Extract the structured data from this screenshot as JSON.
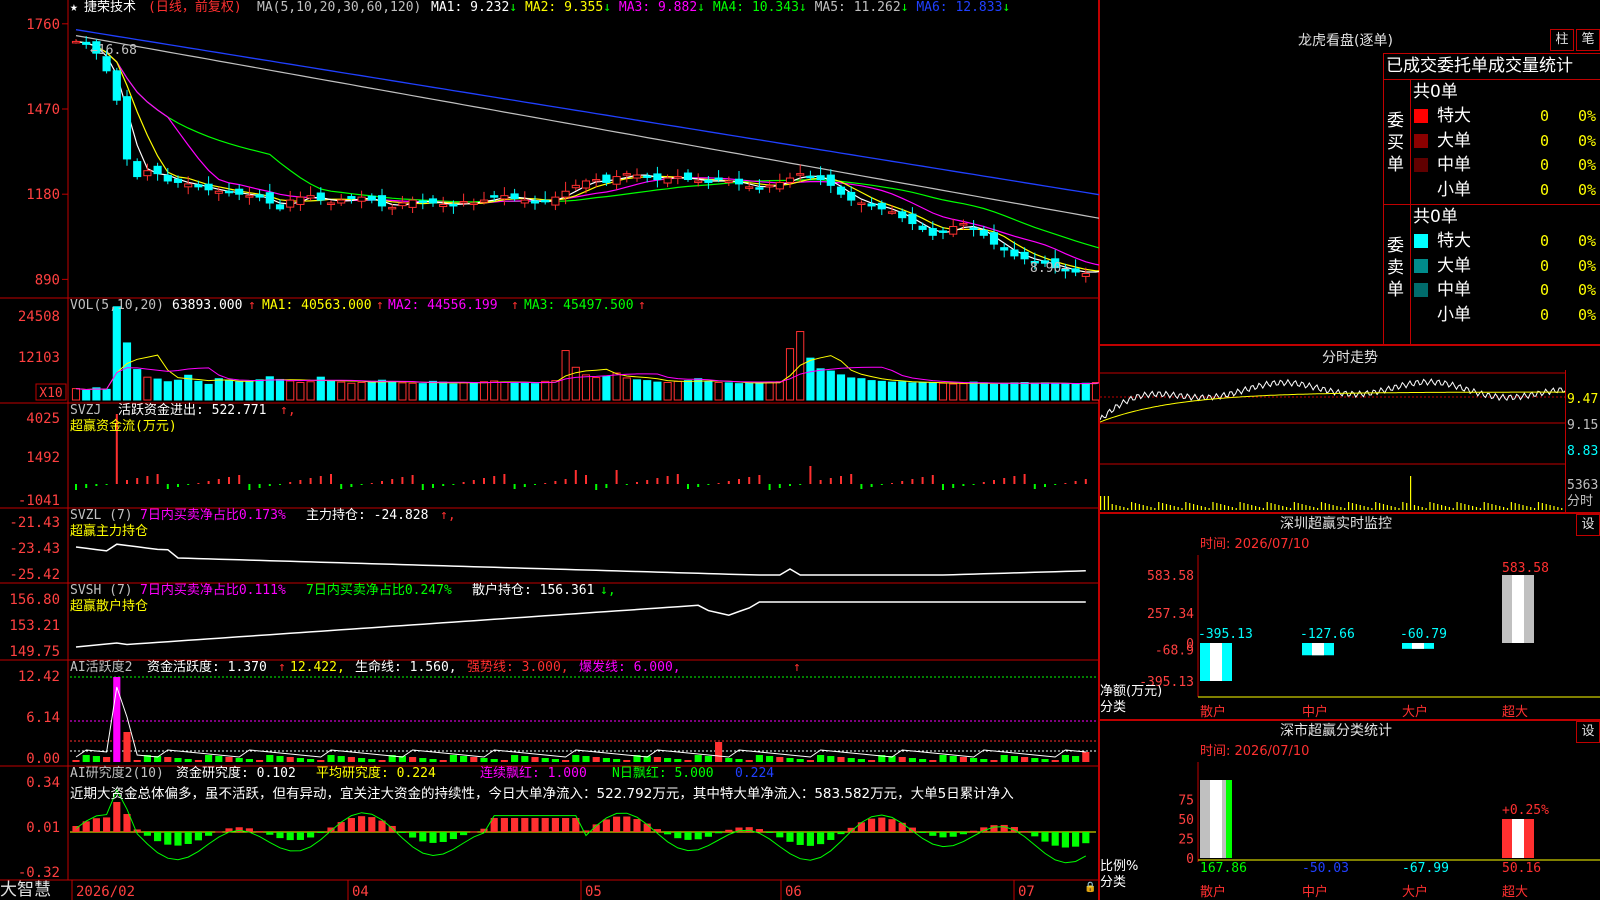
{
  "app": {
    "brand": "大智慧"
  },
  "header": {
    "stock_name": "捷荣技术",
    "period": "(日线，前复权)",
    "ma_label": "MA(5,10,20,30,60,120)",
    "ma": [
      {
        "label": "MA1:",
        "value": "9.232",
        "arrow": "↓",
        "color": "#ffffff"
      },
      {
        "label": "MA2:",
        "value": "9.355",
        "arrow": "↓",
        "color": "#ffff00"
      },
      {
        "label": "MA3:",
        "value": "9.882",
        "arrow": "↓",
        "color": "#ff00ff"
      },
      {
        "label": "MA4:",
        "value": "10.343",
        "arrow": "↓",
        "color": "#00ff00"
      },
      {
        "label": "MA5:",
        "value": "11.262",
        "arrow": "↓",
        "color": "#c0c0c0"
      },
      {
        "label": "MA6:",
        "value": "12.833",
        "arrow": "↓",
        "color": "#2040ff"
      }
    ]
  },
  "colors": {
    "up": "#ff3030",
    "down": "#00ffff",
    "axis": "#c00000",
    "grid_text": "#ff4040",
    "ma1": "#ffffff",
    "ma2": "#ffff00",
    "ma3": "#ff00ff",
    "ma4": "#00ff00",
    "ma5": "#c0c0c0",
    "ma6": "#2040ff"
  },
  "chart_data": [
    {
      "type": "candlestick",
      "y_ticks": [
        "1760",
        "1470",
        "1180",
        "890"
      ],
      "ylim": [
        830,
        1790
      ],
      "annotations": {
        "high_label": "16.68",
        "low_label": "8.90"
      },
      "x_ticks": [
        "2026/02",
        "04",
        "05",
        "06",
        "07"
      ],
      "close_path": [
        1700,
        1690,
        1660,
        1600,
        1500,
        1300,
        1240,
        1260,
        1250,
        1225,
        1220,
        1215,
        1205,
        1195,
        1190,
        1185,
        1180,
        1175,
        1170,
        1150,
        1130,
        1160,
        1170,
        1175,
        1160,
        1150,
        1160,
        1165,
        1170,
        1160,
        1140,
        1135,
        1150,
        1160,
        1155,
        1150,
        1145,
        1140,
        1155,
        1150,
        1160,
        1170,
        1175,
        1165,
        1160,
        1150,
        1155,
        1170,
        1190,
        1210,
        1225,
        1230,
        1220,
        1240,
        1250,
        1245,
        1240,
        1230,
        1235,
        1240,
        1230,
        1225,
        1220,
        1230,
        1225,
        1215,
        1205,
        1200,
        1210,
        1220,
        1235,
        1250,
        1240,
        1230,
        1210,
        1180,
        1160,
        1150,
        1140,
        1130,
        1120,
        1100,
        1080,
        1060,
        1040,
        1050,
        1070,
        1080,
        1060,
        1040,
        1010,
        990,
        970,
        960,
        950,
        945,
        930,
        920,
        915,
        910,
        920,
        930
      ]
    },
    {
      "type": "bar",
      "name": "VOL(5,10,20)",
      "y_ticks": [
        "24508",
        "12103",
        "X10"
      ],
      "values": [
        3000,
        2500,
        3200,
        2800,
        24508,
        15000,
        8000,
        6000,
        5500,
        4800,
        5200,
        6500,
        4900,
        4100,
        5600,
        5200,
        4800,
        4900,
        5300,
        6100,
        5400,
        5000,
        4600,
        4800,
        6000,
        5100,
        4700,
        4400,
        4600,
        4900,
        5200,
        4800,
        4500,
        4400,
        4300,
        4900,
        4700,
        4200,
        4500,
        4600,
        4800,
        5000,
        4700,
        4600,
        4400,
        4300,
        4900,
        5100,
        13000,
        8600,
        6600,
        5900,
        6200,
        7100,
        5800,
        5300,
        5100,
        4700,
        4600,
        4900,
        5100,
        5600,
        4800,
        4600,
        4500,
        4300,
        4400,
        4600,
        4700,
        4800,
        13500,
        18000,
        11000,
        8200,
        7600,
        6600,
        5800,
        5600,
        5100,
        4900,
        4700,
        4800,
        4500,
        4600,
        4500,
        4400,
        4200,
        4300,
        4700,
        4500,
        4100,
        4300,
        4500,
        4600,
        4400,
        4500,
        4300,
        4200,
        4100,
        4400,
        4600,
        7000
      ]
    }
  ],
  "panels": {
    "vol": {
      "label": "VOL(5,10,20)",
      "v": "63893.000",
      "ma1": "MA1: 40563.000",
      "ma2": "MA2: 44556.199",
      "ma3": "MA3: 45497.500",
      "arrow": "↑"
    },
    "svzj": {
      "label": "SVZJ",
      "title": "活跃资金进出: 522.771",
      "arrow": "↑,",
      "sub": "超赢资金流(万元)",
      "ticks": [
        "4025",
        "1492",
        "-1041"
      ]
    },
    "svzl": {
      "label": "SVZL (7)",
      "t1": "7日内买卖净占比0.173%",
      "t2": "主力持仓: -24.828",
      "arrow": "↑,",
      "sub": "超赢主力持仓",
      "ticks": [
        "-21.43",
        "-23.43",
        "-25.42"
      ]
    },
    "svsh": {
      "label": "SVSH (7)",
      "t1": "7日内买卖净占比0.111%",
      "t2": "7日内买卖净占比0.247%",
      "t3": "散户持仓: 156.361",
      "arrow": "↓,",
      "sub": "超赢散户持仓",
      "ticks": [
        "156.80",
        "153.21",
        "149.75"
      ]
    },
    "ai1": {
      "label": "AI活跃度2",
      "t1": "资金活跃度: 1.370",
      "t2": "12.422,",
      "t3": "生命线: 1.560,",
      "t4": "强势线: 3.000,",
      "t5": "爆发线: 6.000,",
      "arrow": "↑",
      "ticks": [
        "12.42",
        "6.14",
        "0.00"
      ]
    },
    "ai2": {
      "label": "AI研究度2(10)",
      "t1": "资金研究度: 0.102",
      "t2": "平均研究度: 0.224",
      "t3": "连续飘红: 1.000",
      "t4": "N日飘红: 5.000",
      "t5": "0.224",
      "ticks": [
        "0.34",
        "0.01",
        "-0.32"
      ],
      "note": "近期大资金总体偏多，虽不活跃，但有异动，宜关注大资金的持续性，今日大单净流入：522.792万元，其中特大单净流入：583.582万元，大单5日累计净入"
    }
  },
  "right": {
    "lhb": {
      "title": "龙虎看盘(逐单)",
      "btn1": "柱",
      "btn2": "笔",
      "header": "已成交委托单成交量统计",
      "buy": {
        "label": "委买单",
        "total": "共0单",
        "rows": [
          {
            "name": "特大",
            "count": "0",
            "pct": "0%",
            "color": "#ff0000"
          },
          {
            "name": "大单",
            "count": "0",
            "pct": "0%",
            "color": "#8b0000"
          },
          {
            "name": "中单",
            "count": "0",
            "pct": "0%",
            "color": "#600000"
          },
          {
            "name": "小单",
            "count": "0",
            "pct": "0%",
            "color": "#000000"
          }
        ]
      },
      "sell": {
        "label": "委卖单",
        "total": "共0单",
        "rows": [
          {
            "name": "特大",
            "count": "0",
            "pct": "0%",
            "color": "#00ffff"
          },
          {
            "name": "大单",
            "count": "0",
            "pct": "0%",
            "color": "#008b8b"
          },
          {
            "name": "中单",
            "count": "0",
            "pct": "0%",
            "color": "#006b6b"
          },
          {
            "name": "小单",
            "count": "0",
            "pct": "0%",
            "color": "#000000"
          }
        ]
      }
    },
    "fs": {
      "title": "分时走势",
      "ticks": [
        "9.47",
        "9.15",
        "8.83"
      ],
      "vol_tick": "5363",
      "vol_unit": "分时"
    },
    "monitor": {
      "title": "深圳超赢实时监控",
      "btn": "设",
      "date": "时间: 2026/07/10",
      "ticks": [
        "583.58",
        "257.34",
        "0",
        "-68.9",
        "-395.13"
      ],
      "ylabel": "净额(万元)",
      "xlabel": "分类",
      "chart_data": {
        "type": "bar",
        "categories": [
          "散户",
          "中户",
          "大户",
          "超大"
        ],
        "values": [
          -395.13,
          -127.66,
          -60.79,
          583.58
        ],
        "ylim": [
          -395.13,
          583.58
        ]
      }
    },
    "classify": {
      "title": "深市超赢分类统计",
      "btn": "设",
      "date": "时间: 2026/07/10",
      "ticks": [
        "75",
        "50",
        "25",
        "0"
      ],
      "ylabel": "比例%",
      "xlabel": "分类",
      "extra": "+0.25%",
      "chart_data": {
        "type": "bar",
        "categories": [
          "散户",
          "中户",
          "大户",
          "超大"
        ],
        "labels": [
          "167.86",
          "-50.03",
          "-67.99",
          "50.16"
        ],
        "values": [
          100,
          0,
          0,
          50
        ],
        "ylim": [
          0,
          100
        ]
      }
    }
  }
}
